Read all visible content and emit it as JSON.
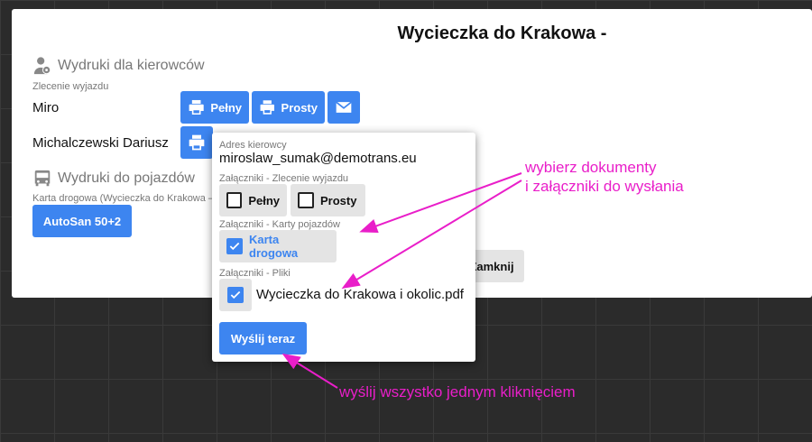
{
  "modal": {
    "title": "Wycieczka do Krakowa -",
    "drivers_section": "Wydruki dla kierowców",
    "order_label": "Zlecenie wyjazdu",
    "drivers": [
      {
        "name": "Miro"
      },
      {
        "name": "Michalczewski Dariusz"
      }
    ],
    "btn_full": "Pełny",
    "btn_simple": "Prosty",
    "vehicles_section": "Wydruki do pojazdów",
    "road_card_label": "Karta drogowa (Wycieczka do Krakowa –",
    "vehicle_btn": "AutoSan 50+2",
    "close_btn": "Zamknij"
  },
  "popup": {
    "address_label": "Adres kierowcy",
    "email": "miroslaw_sumak@demotrans.eu",
    "attach_order_label": "Załączniki - Zlecenie wyjazdu",
    "opt_full": "Pełny",
    "opt_simple": "Prosty",
    "attach_cards_label": "Załączniki - Karty pojazdów",
    "opt_road_card": "Karta drogowa",
    "attach_files_label": "Załączniki - Pliki",
    "file_name": "Wycieczka do Krakowa i okolic.pdf",
    "send_btn": "Wyślij teraz"
  },
  "annotations": {
    "line1": "wybierz dokumenty",
    "line2": "i załączniki do wysłania",
    "line3": "wyślij wszystko jednym kliknięciem"
  },
  "colors": {
    "accent": "#3d85f0",
    "annotation": "#e91ec9"
  }
}
